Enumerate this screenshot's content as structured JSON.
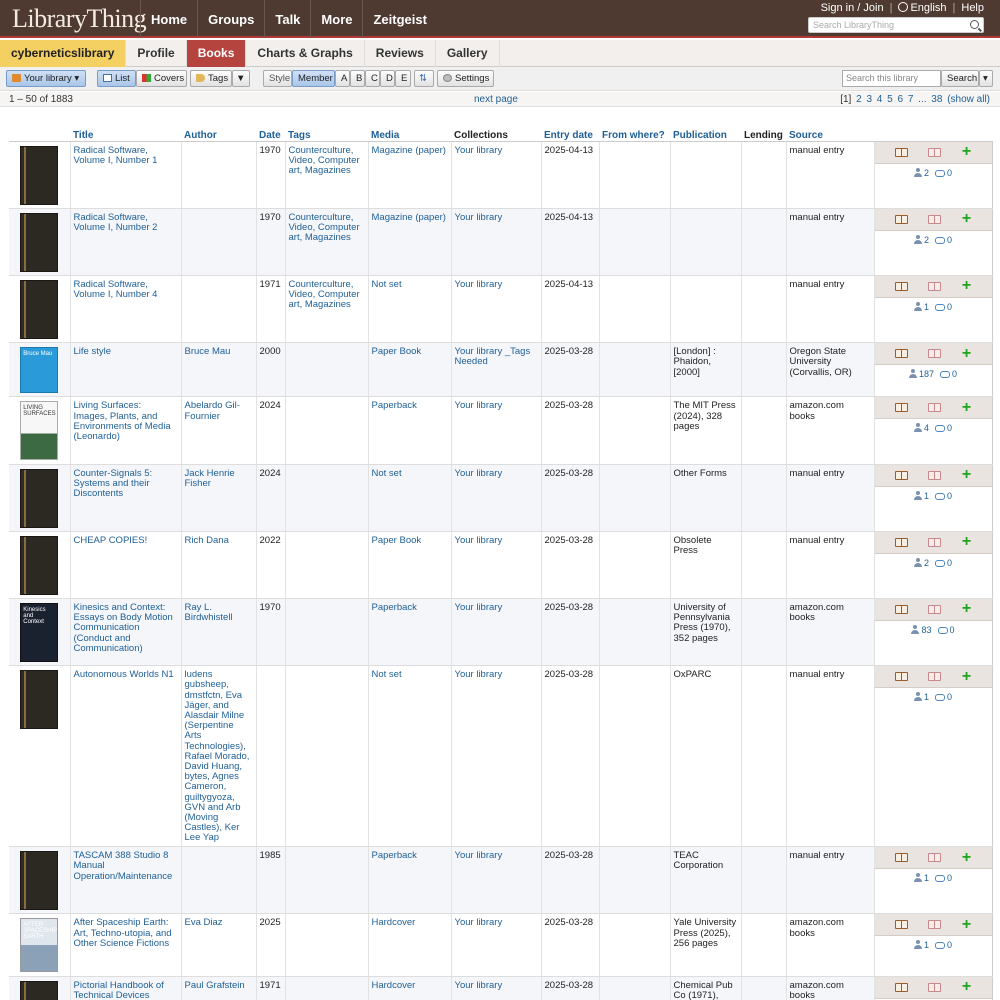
{
  "header": {
    "logo": "LibraryThing",
    "nav": [
      "Home",
      "Groups",
      "Talk",
      "More",
      "Zeitgeist"
    ],
    "sign_in": "Sign in / Join",
    "language": "English",
    "help": "Help",
    "search_placeholder": "Search LibraryThing"
  },
  "tabs": {
    "user": "cyberneticslibrary",
    "items": [
      "Profile",
      "Books",
      "Charts & Graphs",
      "Reviews",
      "Gallery"
    ],
    "active": "Books"
  },
  "toolbar": {
    "your_library": "Your library",
    "list": "List",
    "covers": "Covers",
    "tags": "Tags",
    "style": "Style",
    "member": "Member",
    "letters": [
      "A",
      "B",
      "C",
      "D",
      "E"
    ],
    "settings": "Settings",
    "search_placeholder": "Search this library",
    "search_button": "Search"
  },
  "pager": {
    "range": "1 – 50 of 1883",
    "next": "next page",
    "current": "[1]",
    "pages": [
      "2",
      "3",
      "4",
      "5",
      "6",
      "7",
      "...",
      "38",
      "(show all)"
    ]
  },
  "columns": {
    "title": "Title",
    "author": "Author",
    "date": "Date",
    "tags": "Tags",
    "media": "Media",
    "collections": "Collections",
    "entry_date": "Entry date",
    "from_where": "From where?",
    "publication": "Publication",
    "lending": "Lending",
    "source": "Source"
  },
  "rows": [
    {
      "title": "Radical Software, Volume I, Number 1",
      "author": "",
      "date": "1970",
      "tags": "Counterculture, Video, Computer art, Magazines",
      "media": "Magazine (paper)",
      "collections": "Your library",
      "entry": "2025-04-13",
      "publication": "",
      "source": "manual entry",
      "members": "2",
      "reviews": "0"
    },
    {
      "title": "Radical Software, Volume I, Number 2",
      "author": "",
      "date": "1970",
      "tags": "Counterculture, Video, Computer art, Magazines",
      "media": "Magazine (paper)",
      "collections": "Your library",
      "entry": "2025-04-13",
      "publication": "",
      "source": "manual entry",
      "members": "2",
      "reviews": "0"
    },
    {
      "title": "Radical Software, Volume I, Number 4",
      "author": "",
      "date": "1971",
      "tags": "Counterculture, Video, Computer art, Magazines",
      "media": "Not set",
      "collections": "Your library",
      "entry": "2025-04-13",
      "publication": "",
      "source": "manual entry",
      "members": "1",
      "reviews": "0"
    },
    {
      "title": "Life style",
      "author": "Bruce Mau",
      "date": "2000",
      "tags": "",
      "media": "Paper Book",
      "collections": "Your library _Tags Needed",
      "entry": "2025-03-28",
      "publication": "[London] : Phaidon, [2000]",
      "source": "Oregon State University (Corvallis, OR)",
      "members": "187",
      "reviews": "0"
    },
    {
      "title": "Living Surfaces: Images, Plants, and Environments of Media (Leonardo)",
      "author": "Abelardo Gil-Fournier",
      "date": "2024",
      "tags": "",
      "media": "Paperback",
      "collections": "Your library",
      "entry": "2025-03-28",
      "publication": "The MIT Press (2024), 328 pages",
      "source": "amazon.com books",
      "members": "4",
      "reviews": "0"
    },
    {
      "title": "Counter-Signals 5: Systems and their Discontents",
      "author": "Jack Henrie Fisher",
      "date": "2024",
      "tags": "",
      "media": "Not set",
      "collections": "Your library",
      "entry": "2025-03-28",
      "publication": "Other Forms",
      "source": "manual entry",
      "members": "1",
      "reviews": "0"
    },
    {
      "title": "CHEAP COPIES!",
      "author": "Rich Dana",
      "date": "2022",
      "tags": "",
      "media": "Paper Book",
      "collections": "Your library",
      "entry": "2025-03-28",
      "publication": "Obsolete Press",
      "source": "manual entry",
      "members": "2",
      "reviews": "0"
    },
    {
      "title": "Kinesics and Context: Essays on Body Motion Communication (Conduct and Communication)",
      "author": "Ray L. Birdwhistell",
      "date": "1970",
      "tags": "",
      "media": "Paperback",
      "collections": "Your library",
      "entry": "2025-03-28",
      "publication": "University of Pennsylvania Press (1970), 352 pages",
      "source": "amazon.com books",
      "members": "83",
      "reviews": "0"
    },
    {
      "title": "Autonomous Worlds N1",
      "author": "ludens gubsheep, dmstfctn, Eva Jäger, and Alasdair Milne (Serpentine Arts Technologies), Rafael Morado, David Huang, bytes, Agnes Cameron, guiltygyoza, GVN and Arb (Moving Castles), Ker Lee Yap",
      "date": "",
      "tags": "",
      "media": "Not set",
      "collections": "Your library",
      "entry": "2025-03-28",
      "publication": "OxPARC",
      "source": "manual entry",
      "members": "1",
      "reviews": "0"
    },
    {
      "title": "TASCAM 388 Studio 8 Manual Operation/Maintenance",
      "author": "",
      "date": "1985",
      "tags": "",
      "media": "Paperback",
      "collections": "Your library",
      "entry": "2025-03-28",
      "publication": "TEAC Corporation",
      "source": "manual entry",
      "members": "1",
      "reviews": "0"
    },
    {
      "title": "After Spaceship Earth: Art, Techno-utopia, and Other Science Fictions",
      "author": "Eva Diaz",
      "date": "2025",
      "tags": "",
      "media": "Hardcover",
      "collections": "Your library",
      "entry": "2025-03-28",
      "publication": "Yale University Press (2025), 256 pages",
      "source": "amazon.com books",
      "members": "1",
      "reviews": "0"
    },
    {
      "title": "Pictorial Handbook of Technical Devices",
      "author": "Paul Grafstein",
      "date": "1971",
      "tags": "",
      "media": "Hardcover",
      "collections": "Your library",
      "entry": "2025-03-28",
      "publication": "Chemical Pub Co (1971),",
      "source": "amazon.com books",
      "members": "",
      "reviews": ""
    }
  ],
  "covers": {
    "life_style": "Bruce Mau",
    "living": "LIVING SURFACES",
    "kinesics": "Kinesics and Context",
    "ship": "AFTER SPACESHIP EARTH"
  }
}
